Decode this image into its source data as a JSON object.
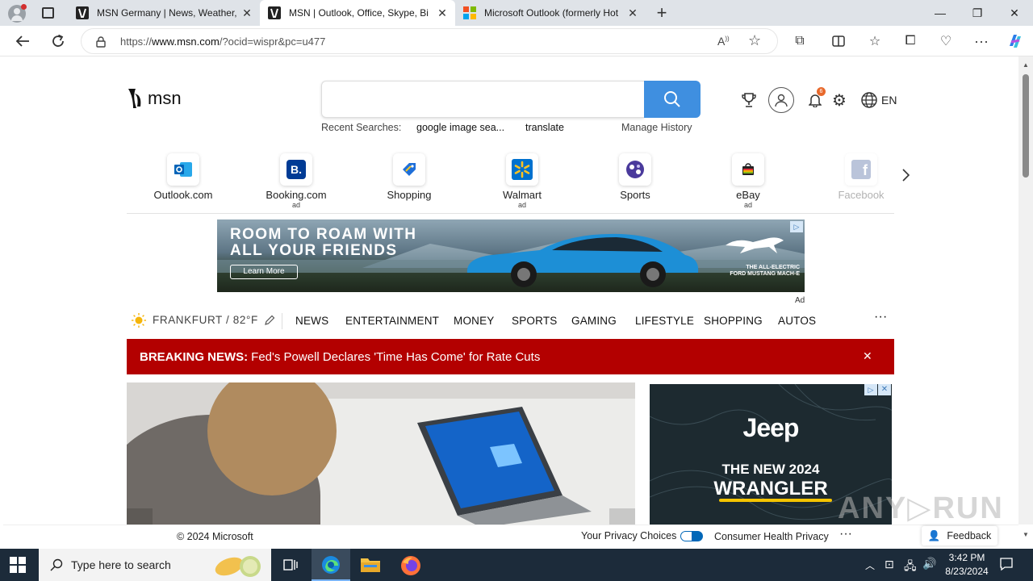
{
  "tabs": [
    {
      "title": "MSN Germany | News, Weather, ",
      "active": false
    },
    {
      "title": "MSN | Outlook, Office, Skype, Bi",
      "active": true
    },
    {
      "title": "Microsoft Outlook (formerly Hot",
      "active": false
    }
  ],
  "address": {
    "prefix": "https://",
    "host": "www.msn.com",
    "path": "/?ocid=wispr&pc=u477"
  },
  "msn": {
    "logo_text": "msn",
    "recent_label": "Recent Searches:",
    "recent": [
      "google image sea...",
      "translate"
    ],
    "manage_history": "Manage History",
    "notification_count": "6",
    "language": "EN"
  },
  "quicklinks": [
    {
      "label": "Outlook.com",
      "ad": ""
    },
    {
      "label": "Booking.com",
      "ad": "ad"
    },
    {
      "label": "Shopping",
      "ad": ""
    },
    {
      "label": "Walmart",
      "ad": "ad"
    },
    {
      "label": "Sports",
      "ad": ""
    },
    {
      "label": "eBay",
      "ad": "ad"
    },
    {
      "label": "Facebook",
      "ad": ""
    }
  ],
  "banner": {
    "headline_1": "ROOM TO ROAM WITH",
    "headline_2": "ALL YOUR FRIENDS",
    "cta": "Learn More",
    "tag_1": "THE ALL-ELECTRIC",
    "tag_2": "FORD MUSTANG MACH-E",
    "ad_label": "Ad"
  },
  "weather": {
    "city": "FRANKFURT",
    "temp": "82°F"
  },
  "categories": [
    "NEWS",
    "ENTERTAINMENT",
    "MONEY",
    "SPORTS",
    "GAMING",
    "LIFESTYLE",
    "SHOPPING",
    "AUTOS"
  ],
  "breaking": {
    "label": "BREAKING NEWS:",
    "text": "Fed's Powell Declares 'Time Has Come' for Rate Cuts"
  },
  "jeep_ad": {
    "brand": "Jeep",
    "line_1": "THE NEW 2024",
    "line_2": "WRANGLER"
  },
  "footer": {
    "copyright": "© 2024 Microsoft",
    "privacy_choices": "Your Privacy Choices",
    "health_privacy": "Consumer Health Privacy",
    "feedback": "Feedback"
  },
  "taskbar": {
    "search_placeholder": "Type here to search",
    "time": "3:42 PM",
    "date": "8/23/2024"
  },
  "colors": {
    "accent": "#3f8fe0",
    "breaking_bg": "#b30000",
    "taskbar": "#1c2b3a"
  }
}
